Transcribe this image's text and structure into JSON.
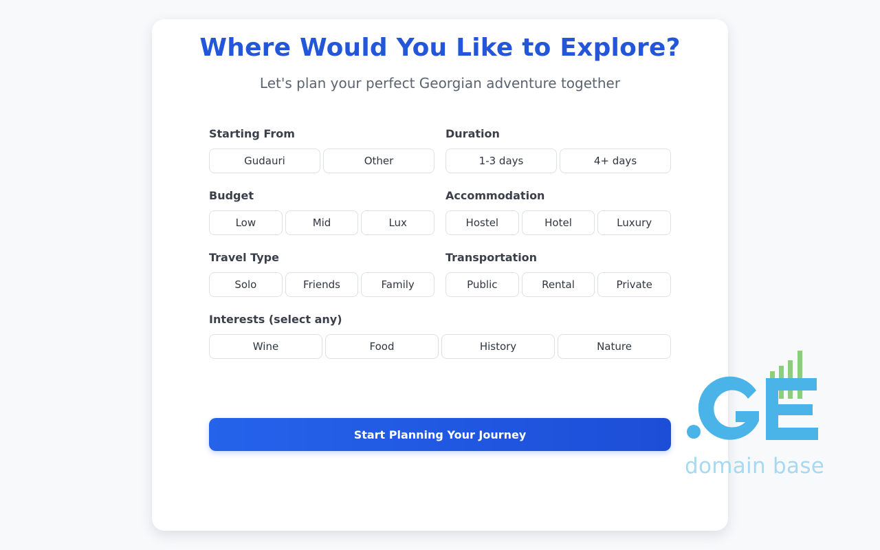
{
  "header": {
    "title": "Where Would You Like to Explore?",
    "subtitle": "Let's plan your perfect Georgian adventure together"
  },
  "form": {
    "starting_from": {
      "label": "Starting From",
      "options": [
        "Gudauri",
        "Other"
      ]
    },
    "duration": {
      "label": "Duration",
      "options": [
        "1-3 days",
        "4+ days"
      ]
    },
    "budget": {
      "label": "Budget",
      "options": [
        "Low",
        "Mid",
        "Lux"
      ]
    },
    "accommodation": {
      "label": "Accommodation",
      "options": [
        "Hostel",
        "Hotel",
        "Luxury"
      ]
    },
    "travel_type": {
      "label": "Travel Type",
      "options": [
        "Solo",
        "Friends",
        "Family"
      ]
    },
    "transportation": {
      "label": "Transportation",
      "options": [
        "Public",
        "Rental",
        "Private"
      ]
    },
    "interests": {
      "label": "Interests (select any)",
      "options": [
        "Wine",
        "Food",
        "History",
        "Nature"
      ]
    },
    "submit_label": "Start Planning Your Journey"
  },
  "logo": {
    "mark": ".GE",
    "text": "domain base",
    "colors": {
      "blue": "#4ab3e8",
      "green": "#8ccf7a",
      "text": "#a9d8f1"
    }
  },
  "colors": {
    "accent": "#2356d8",
    "button": "#2563eb",
    "background": "#f7f9fb",
    "card": "#ffffff"
  }
}
